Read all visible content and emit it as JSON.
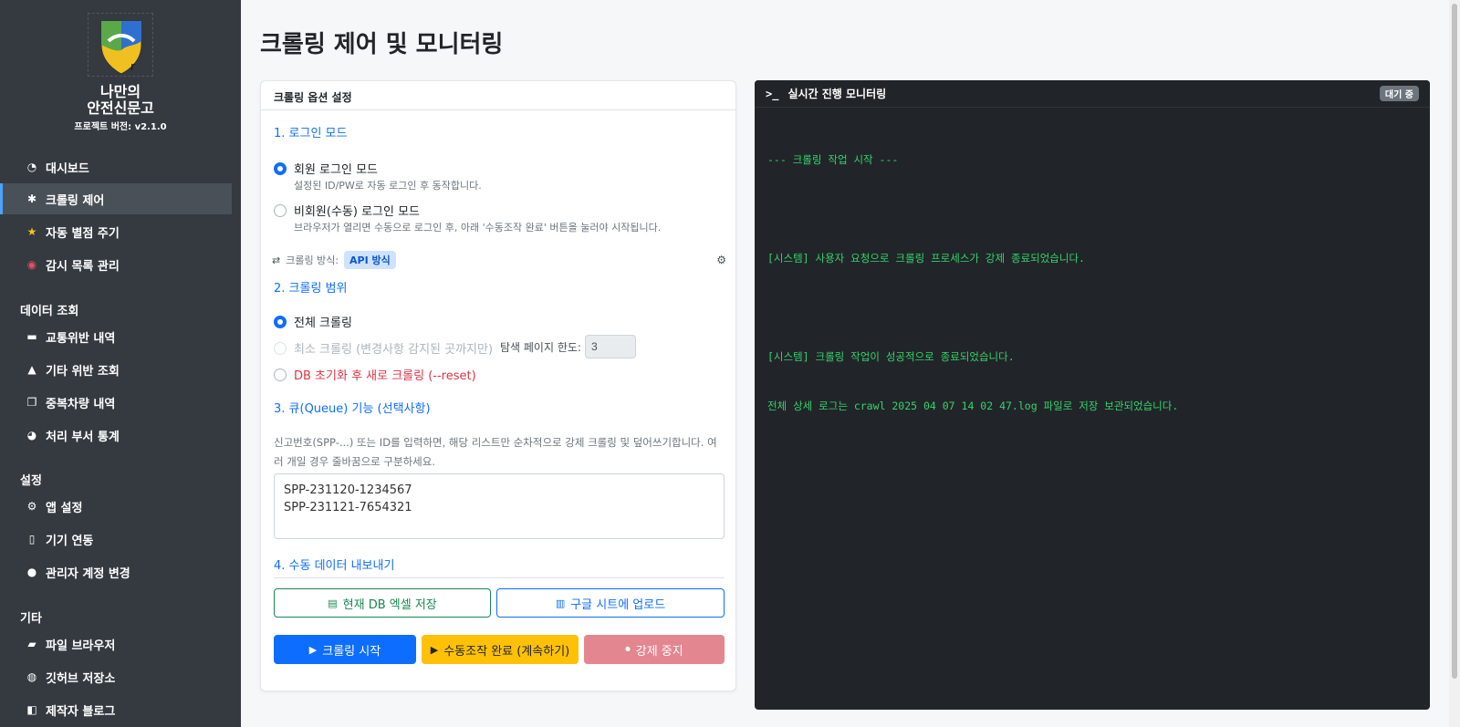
{
  "sidebar": {
    "brand_line1": "나만의",
    "brand_line2": "안전신문고",
    "version": "프로젝트 버전: v2.1.0",
    "nav": [
      {
        "label": "대시보드",
        "icon": "dashboard-icon"
      },
      {
        "label": "크롤링 제어",
        "icon": "bug-icon",
        "active": true
      },
      {
        "label": "자동 별점 주기",
        "icon": "star-icon"
      },
      {
        "label": "감시 목록 관리",
        "icon": "eye-icon"
      }
    ],
    "section_data": "데이터 조회",
    "data_items": [
      {
        "label": "교통위반 내역",
        "icon": "car-icon"
      },
      {
        "label": "기타 위반 조회",
        "icon": "warning-icon"
      },
      {
        "label": "중복차량 내역",
        "icon": "clone-icon"
      },
      {
        "label": "처리 부서 통계",
        "icon": "pie-chart-icon"
      }
    ],
    "section_settings": "설정",
    "settings_items": [
      {
        "label": "앱 설정",
        "icon": "gear-icon"
      },
      {
        "label": "기기 연동",
        "icon": "mobile-icon"
      },
      {
        "label": "관리자 계정 변경",
        "icon": "user-cog-icon"
      }
    ],
    "section_etc": "기타",
    "etc_items": [
      {
        "label": "파일 브라우저",
        "icon": "folder-icon"
      },
      {
        "label": "깃허브 저장소",
        "icon": "github-icon"
      },
      {
        "label": "제작자 블로그",
        "icon": "blog-icon"
      }
    ]
  },
  "main": {
    "title": "크롤링 제어 및 모니터링"
  },
  "options": {
    "header": "크롤링 옵션 설정",
    "sec1": "1. 로그인 모드",
    "login_member": "회원 로그인 모드",
    "login_member_help": "설정된 ID/PW로 자동 로그인 후 동작합니다.",
    "login_guest": "비회원(수동) 로그인 모드",
    "login_guest_help": "브라우저가 열리면 수동으로 로그인 후, 아래 '수동조작 완료' 버튼을 눌러야 시작됩니다.",
    "method_label": "크롤링 방식:",
    "method_badge": "API 방식",
    "sec2": "2. 크롤링 범위",
    "range_full": "전체 크롤링",
    "range_min": "최소 크롤링 (변경사항 감지된 곳까지만)",
    "search_pages_label": "탐색 페이지 한도:",
    "search_pages_value": "3",
    "range_reset": "DB 초기화 후 새로 크롤링 (--reset)",
    "sec3": "3. 큐(Queue) 기능 (선택사항)",
    "queue_help": "신고번호(SPP-...) 또는 ID를 입력하면, 해당 리스트만 순차적으로 강제 크롤링 및 덮어쓰기합니다. 여러 개일 경우 줄바꿈으로 구분하세요.",
    "queue_line1": "SPP-231120-1234567",
    "queue_line2": "SPP-231121-7654321",
    "sec4": "4. 수동 데이터 내보내기",
    "btn_excel": "현재 DB 엑셀 저장",
    "btn_gsheet": "구글 시트에 업로드",
    "btn_start": "크롤링 시작",
    "btn_manual_done": "수동조작 완료 (계속하기)",
    "btn_stop": "강제 중지"
  },
  "monitor": {
    "header": "실시간 진행 모니터링",
    "status": "대기 중",
    "log": [
      "--- 크롤링 작업 시작 ---",
      "",
      "[시스템] 사용자 요청으로 크롤링 프로세스가 강제 종료되었습니다.",
      "",
      "[시스템] 크롤링 작업이 성공적으로 종료되었습니다.",
      "전체 상세 로그는 crawl 2025 04 07 14 02 47.log 파일로 저장 보관되었습니다."
    ]
  },
  "colors": {
    "sidebar_bg": "#343a40",
    "primary": "#0d6efd",
    "success": "#198754",
    "warning": "#ffc107",
    "danger": "#dc3545",
    "terminal_text": "#36d36a"
  }
}
